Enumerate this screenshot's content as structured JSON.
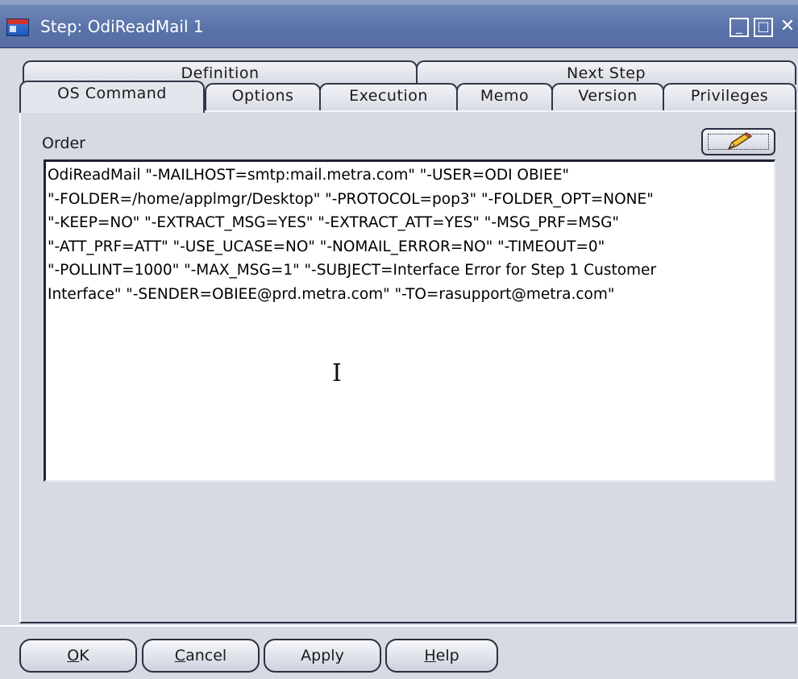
{
  "window": {
    "title": "Step: OdiReadMail 1",
    "controls": {
      "minimize": "_",
      "maximize": "□",
      "close": "✕"
    }
  },
  "tabs": {
    "row1": [
      {
        "label": "Definition"
      },
      {
        "label": "Next Step"
      }
    ],
    "row2": [
      {
        "label": "OS Command",
        "active": true
      },
      {
        "label": "Options"
      },
      {
        "label": "Execution"
      },
      {
        "label": "Memo"
      },
      {
        "label": "Version"
      },
      {
        "label": "Privileges"
      }
    ]
  },
  "content": {
    "order_label": "Order",
    "command_lines": [
      "OdiReadMail \"-MAILHOST=smtp:mail.metra.com\" \"-USER=ODI OBIEE\"",
      "\"-FOLDER=/home/applmgr/Desktop\" \"-PROTOCOL=pop3\" \"-FOLDER_OPT=NONE\"",
      "\"-KEEP=NO\" \"-EXTRACT_MSG=YES\" \"-EXTRACT_ATT=YES\" \"-MSG_PRF=MSG\"",
      "\"-ATT_PRF=ATT\" \"-USE_UCASE=NO\" \"-NOMAIL_ERROR=NO\" \"-TIMEOUT=0\"",
      "\"-POLLINT=1000\" \"-MAX_MSG=1\" \"-SUBJECT=Interface Error for Step 1 Customer",
      "Interface\" \"-SENDER=OBIEE@prd.metra.com\" \"-TO=rasupport@metra.com\""
    ]
  },
  "buttons": {
    "ok": {
      "mnemonic": "O",
      "rest": "K"
    },
    "cancel": {
      "mnemonic": "C",
      "rest": "ancel"
    },
    "apply": {
      "label": "Apply"
    },
    "help": {
      "mnemonic": "H",
      "rest": "elp"
    }
  },
  "icons": {
    "edit": "pencil-icon",
    "text_cursor": "text-cursor-icon"
  }
}
